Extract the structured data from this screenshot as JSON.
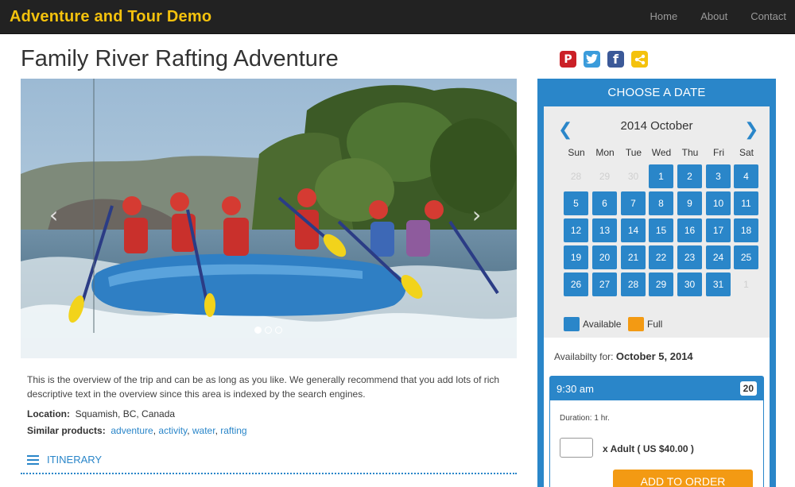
{
  "app": {
    "brand": "Adventure and Tour Demo"
  },
  "nav": {
    "items": [
      "Home",
      "About",
      "Contact"
    ]
  },
  "page": {
    "title": "Family River Rafting Adventure"
  },
  "share": {
    "icons": [
      "pinterest-icon",
      "twitter-icon",
      "facebook-icon",
      "share-icon"
    ],
    "colors": {
      "pinterest": "#cb2027",
      "twitter": "#3b9cdb",
      "facebook": "#3b5998",
      "share": "#f4c20d"
    }
  },
  "gallery": {
    "slides": 3,
    "active_slide": 1,
    "prev_arrow": "‹",
    "next_arrow": "›"
  },
  "overview": {
    "text": "This is the overview of the trip and can be as long as you like.  We generally recommend that you add lots of rich descriptive text in the overview since this area is indexed by the search engines.",
    "location_label": "Location:",
    "location_value": "Squamish, BC, Canada",
    "similar_label": "Similar products:",
    "similar_links": [
      "adventure",
      "activity",
      "water",
      "rafting"
    ],
    "itinerary_label": "ITINERARY"
  },
  "booking": {
    "header": "CHOOSE A DATE",
    "calendar": {
      "month_title": "2014 October",
      "weekdays": [
        "Sun",
        "Mon",
        "Tue",
        "Wed",
        "Thu",
        "Fri",
        "Sat"
      ],
      "leading_days": [
        "28",
        "29",
        "30"
      ],
      "days": [
        "1",
        "2",
        "3",
        "4",
        "5",
        "6",
        "7",
        "8",
        "9",
        "10",
        "11",
        "12",
        "13",
        "14",
        "15",
        "16",
        "17",
        "18",
        "19",
        "20",
        "21",
        "22",
        "23",
        "24",
        "25",
        "26",
        "27",
        "28",
        "29",
        "30",
        "31"
      ],
      "trailing_days": [
        "1"
      ],
      "available_color": "#2a86c9",
      "full_color": "#f39a13"
    },
    "legend": {
      "available": "Available",
      "full": "Full"
    },
    "availability": {
      "label": "Availabilty for:",
      "date": "October 5, 2014",
      "slot_time": "9:30 am",
      "slot_count": "20",
      "duration": "Duration: 1 hr.",
      "quantity": "",
      "price_label": "x Adult ( US $40.00 )",
      "order_button": "ADD TO ORDER"
    }
  }
}
